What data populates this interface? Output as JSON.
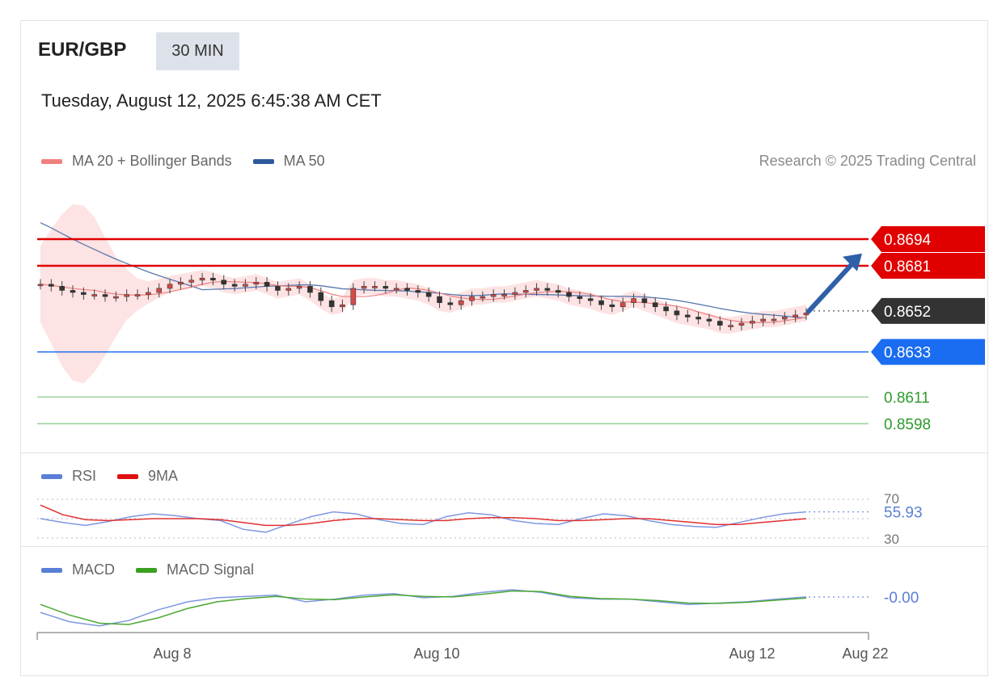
{
  "header": {
    "symbol": "EUR/GBP",
    "interval": "30 MIN",
    "datetime": "Tuesday, August 12, 2025 6:45:38 AM CET",
    "credit": "Research © 2025 Trading Central"
  },
  "legends": {
    "price": [
      {
        "name": "MA 20 + Bollinger Bands",
        "color": "#f08080"
      },
      {
        "name": "MA 50",
        "color": "#2d5a9c"
      }
    ],
    "rsi": [
      {
        "name": "RSI",
        "color": "#5b7fd6"
      },
      {
        "name": "9MA",
        "color": "#e01010"
      }
    ],
    "macd": [
      {
        "name": "MACD",
        "color": "#5b7fd6"
      },
      {
        "name": "MACD Signal",
        "color": "#3aa020"
      }
    ]
  },
  "colors": {
    "resistance": "#e00000",
    "support_main": "#1a6cf0",
    "support_minor": "#2e9a2e",
    "current": "#333333",
    "arrow": "#2f5fa8",
    "band_fill": "#fde3e3"
  },
  "chart_data": [
    {
      "type": "candlestick",
      "panel": "price",
      "ylim": [
        0.859,
        0.872
      ],
      "x_tick_labels": [
        "Aug 8",
        "Aug 10",
        "Aug 12",
        "Aug 22"
      ],
      "close_series": [
        0.8672,
        0.8671,
        0.8669,
        0.8668,
        0.8667,
        0.8667,
        0.8666,
        0.8666,
        0.8667,
        0.8667,
        0.8668,
        0.867,
        0.8672,
        0.8673,
        0.8674,
        0.8675,
        0.8674,
        0.8672,
        0.8671,
        0.8672,
        0.8673,
        0.8671,
        0.8669,
        0.867,
        0.8671,
        0.8668,
        0.8664,
        0.8661,
        0.8662,
        0.867,
        0.8671,
        0.8671,
        0.867,
        0.867,
        0.8669,
        0.8668,
        0.8666,
        0.8663,
        0.8662,
        0.8664,
        0.8666,
        0.8666,
        0.8667,
        0.8667,
        0.8668,
        0.8669,
        0.867,
        0.8669,
        0.8668,
        0.8666,
        0.8665,
        0.8664,
        0.8662,
        0.8661,
        0.8663,
        0.8665,
        0.8663,
        0.8661,
        0.8659,
        0.8657,
        0.8656,
        0.8655,
        0.8654,
        0.8652,
        0.8652,
        0.8653,
        0.8654,
        0.8655,
        0.8655,
        0.8656,
        0.8657,
        0.8658
      ],
      "levels": [
        {
          "value": "0.8694",
          "kind": "resistance",
          "price": 0.8694
        },
        {
          "value": "0.8681",
          "kind": "resistance",
          "price": 0.8681
        },
        {
          "value": "0.8652",
          "kind": "current",
          "price": 0.8659
        },
        {
          "value": "0.8633",
          "kind": "support",
          "price": 0.8639
        },
        {
          "value": "0.8611",
          "kind": "minor-support",
          "price": 0.8617
        },
        {
          "value": "0.8598",
          "kind": "minor-support",
          "price": 0.8604
        }
      ],
      "arrow_target": 0.8687
    },
    {
      "type": "line",
      "panel": "rsi",
      "ylim": [
        25,
        75
      ],
      "tick_labels": [
        "70",
        "30"
      ],
      "current_value": "55.93",
      "series": [
        {
          "name": "RSI",
          "values": [
            50,
            46,
            43,
            47,
            52,
            55,
            53,
            50,
            48,
            39,
            36,
            44,
            52,
            57,
            55,
            49,
            45,
            44,
            52,
            56,
            54,
            48,
            45,
            44,
            50,
            55,
            53,
            48,
            44,
            42,
            41,
            46,
            51,
            55,
            57
          ]
        },
        {
          "name": "9MA",
          "values": [
            64,
            54,
            49,
            48,
            49,
            50,
            50,
            50,
            49,
            46,
            43,
            43,
            45,
            48,
            50,
            50,
            49,
            48,
            48,
            50,
            51,
            51,
            50,
            48,
            48,
            49,
            50,
            50,
            48,
            46,
            44,
            44,
            46,
            48,
            50
          ]
        }
      ]
    },
    {
      "type": "line",
      "panel": "macd",
      "current_value": "-0.00",
      "series": [
        {
          "name": "MACD",
          "values": [
            -0.2,
            -0.55,
            -0.7,
            -0.5,
            -0.1,
            0.2,
            0.35,
            0.4,
            0.45,
            0.2,
            0.3,
            0.45,
            0.5,
            0.35,
            0.4,
            0.55,
            0.65,
            0.55,
            0.35,
            0.3,
            0.3,
            0.2,
            0.1,
            0.15,
            0.2,
            0.3,
            0.38
          ]
        },
        {
          "name": "MACD Signal",
          "values": [
            0.1,
            -0.3,
            -0.6,
            -0.65,
            -0.4,
            -0.05,
            0.2,
            0.32,
            0.4,
            0.3,
            0.28,
            0.38,
            0.46,
            0.4,
            0.38,
            0.48,
            0.6,
            0.58,
            0.4,
            0.32,
            0.3,
            0.24,
            0.15,
            0.14,
            0.18,
            0.26,
            0.34
          ]
        }
      ]
    }
  ]
}
